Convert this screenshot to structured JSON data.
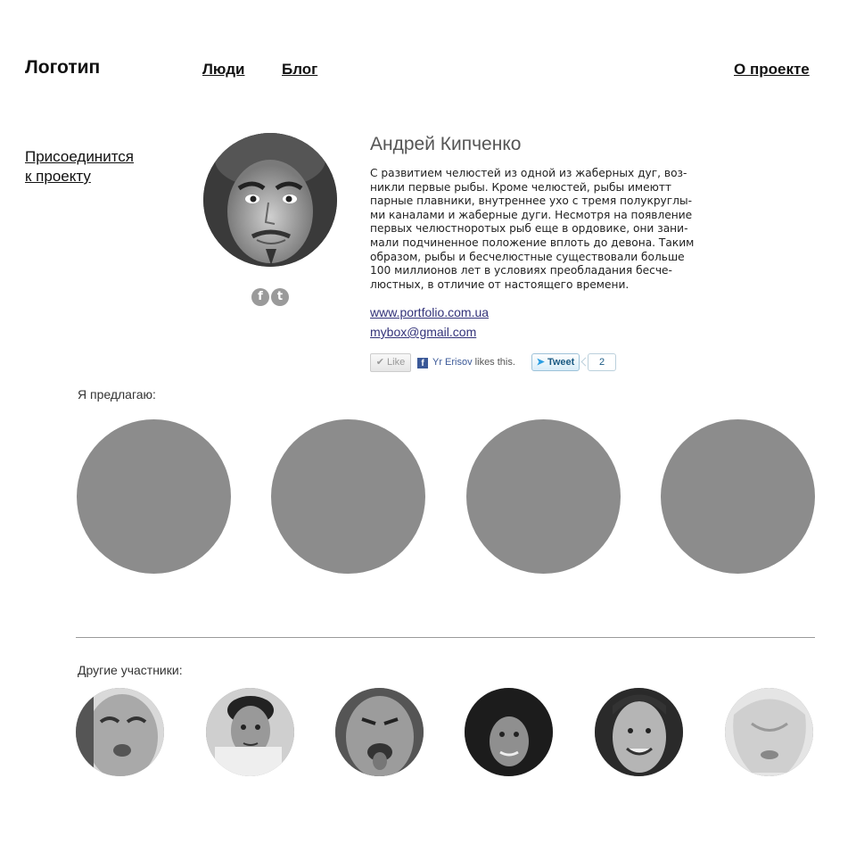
{
  "header": {
    "logo": "Логотип",
    "nav": [
      {
        "label": "Люди"
      },
      {
        "label": "Блог"
      }
    ],
    "about": "О проекте"
  },
  "sidebar": {
    "join_line1": "Присоединится",
    "join_line2": "к проекту"
  },
  "profile": {
    "name": "Андрей Кипченко",
    "bio_lines": [
      "С развитием челюстей из одной из жаберных дуг, воз-",
      "никли первые рыбы. Кроме челюстей, рыбы имеютт",
      "парные плавники, внутреннее ухо с тремя полукруглы-",
      "ми каналами и жаберные дуги. Несмотря на появление",
      "первых челюстноротых рыб еще в ордовике, они зани-",
      "мали подчиненное положение вплоть до девона. Таким",
      "образом, рыбы и бесчелюстные существовали больше",
      "100 миллионов лет в условиях преобладания бесче-",
      "люстных, в отличие от настоящего времени."
    ],
    "website": "www.portfolio.com.ua",
    "email": "mybox@gmail.com",
    "social_icons": [
      {
        "icon": "facebook-icon",
        "glyph": "f"
      },
      {
        "icon": "tumblr-icon",
        "glyph": "t"
      }
    ]
  },
  "share": {
    "like_label": "Like",
    "fb_glyph": "f",
    "fb_user": "Yr Erisov",
    "fb_suffix": " likes this.",
    "tweet_label": "Tweet",
    "tweet_count": "2"
  },
  "offers": {
    "label": "Я предлагаю:",
    "count": 4,
    "placeholder_color": "#8c8c8c"
  },
  "members": {
    "label": "Другие участники:",
    "count": 6
  }
}
